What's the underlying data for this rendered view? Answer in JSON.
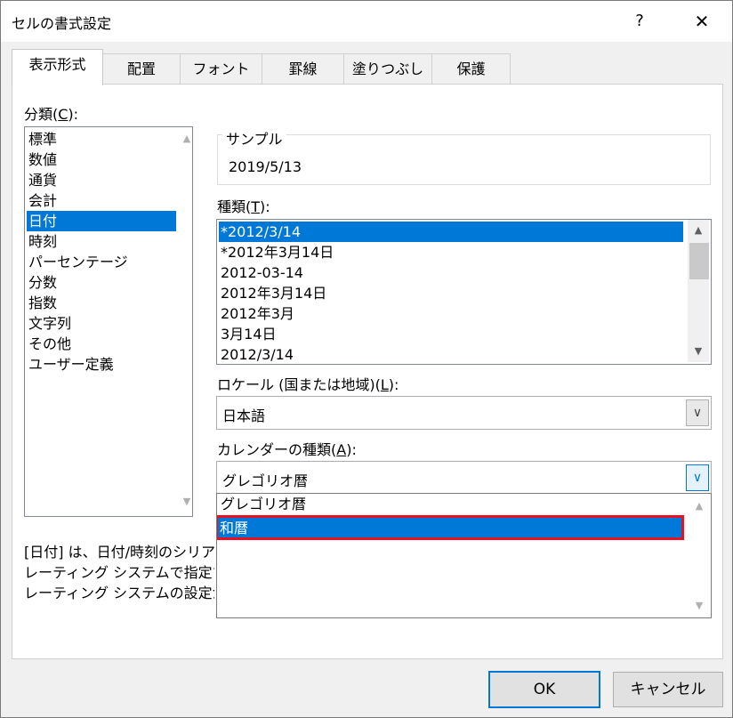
{
  "window": {
    "title": "セルの書式設定",
    "help": "?",
    "close": "✕"
  },
  "tabs": [
    {
      "label": "表示形式"
    },
    {
      "label": "配置"
    },
    {
      "label": "フォント"
    },
    {
      "label": "罫線"
    },
    {
      "label": "塗りつぶし"
    },
    {
      "label": "保護"
    }
  ],
  "category": {
    "label_prefix": "分類(",
    "label_key": "C",
    "label_suffix": "):",
    "items": [
      "標準",
      "数値",
      "通貨",
      "会計",
      "日付",
      "時刻",
      "パーセンテージ",
      "分数",
      "指数",
      "文字列",
      "その他",
      "ユーザー定義"
    ],
    "selected": "日付"
  },
  "sample": {
    "label": "サンプル",
    "value": "2019/5/13"
  },
  "type": {
    "label_prefix": "種類(",
    "label_key": "T",
    "label_suffix": "):",
    "items": [
      "*2012/3/14",
      "*2012年3月14日",
      "2012-03-14",
      "2012年3月14日",
      "2012年3月",
      "3月14日",
      "2012/3/14"
    ],
    "selected": "*2012/3/14"
  },
  "locale": {
    "label_prefix": "ロケール (国または地域)(",
    "label_key": "L",
    "label_suffix": "):",
    "value": "日本語"
  },
  "calendar": {
    "label_prefix": "カレンダーの種類(",
    "label_key": "A",
    "label_suffix": "):",
    "value": "グレゴリオ暦",
    "options": [
      "グレゴリオ暦",
      "和暦"
    ],
    "highlighted": "和暦"
  },
  "description": {
    "line1": "[日付] は、日付/時刻のシリア",
    "line2": "レーティング システムで指定する",
    "line3": "レーティング システムの設定が変"
  },
  "buttons": {
    "ok": "OK",
    "cancel": "キャンセル"
  },
  "colors": {
    "selection": "#0078d7",
    "highlight_border": "#e81123"
  },
  "icons": {
    "scroll_up": "chevron-up-icon",
    "scroll_down": "chevron-down-icon",
    "combo": "chevron-down-icon"
  }
}
